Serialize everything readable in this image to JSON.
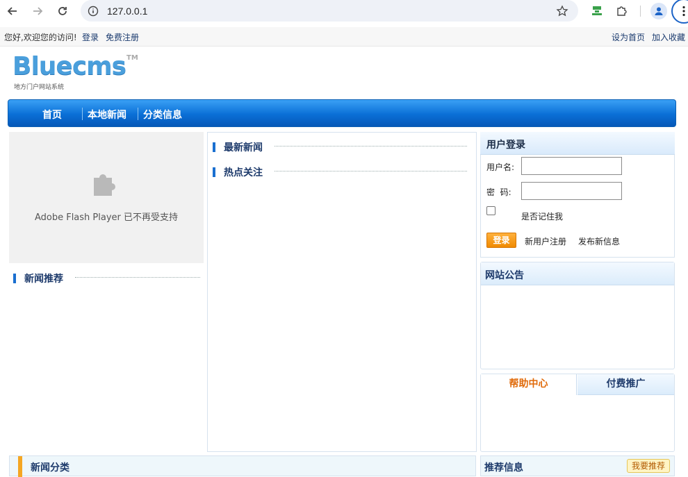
{
  "browser": {
    "url": "127.0.0.1",
    "back_icon": "arrow-left-icon",
    "forward_icon": "arrow-right-icon",
    "reload_icon": "reload-icon"
  },
  "topbar": {
    "welcome": "您好,欢迎您的访问!",
    "login": "登录",
    "register": "免费注册",
    "set_home": "设为首页",
    "bookmark": "加入收藏"
  },
  "logo": {
    "name": "Bluecms",
    "tm": "TM",
    "tagline": "地方门户网站系统"
  },
  "nav": {
    "items": [
      "首页",
      "本地新闻",
      "分类信息"
    ]
  },
  "flash": {
    "message": "Adobe Flash Player 已不再受支持"
  },
  "sections": {
    "news_recommend": "新闻推荐",
    "latest_news": "最新新闻",
    "hot_focus": "热点关注"
  },
  "login": {
    "title": "用户登录",
    "username_label": "用户名:",
    "password_label": "密  码:",
    "remember": "是否记住我",
    "submit": "登录",
    "new_user": "新用户注册",
    "post_info": "发布新信息"
  },
  "notice": {
    "title": "网站公告"
  },
  "tabs": {
    "help": "帮助中心",
    "paid_promo": "付费推广"
  },
  "bottom": {
    "news_category": "新闻分类",
    "recommended_info": "推荐信息",
    "recommend_badge": "我要推荐"
  },
  "colors": {
    "nav_blue": "#0a6fd6",
    "accent_orange": "#f08a00",
    "heading_blue": "#1d3a6b"
  }
}
